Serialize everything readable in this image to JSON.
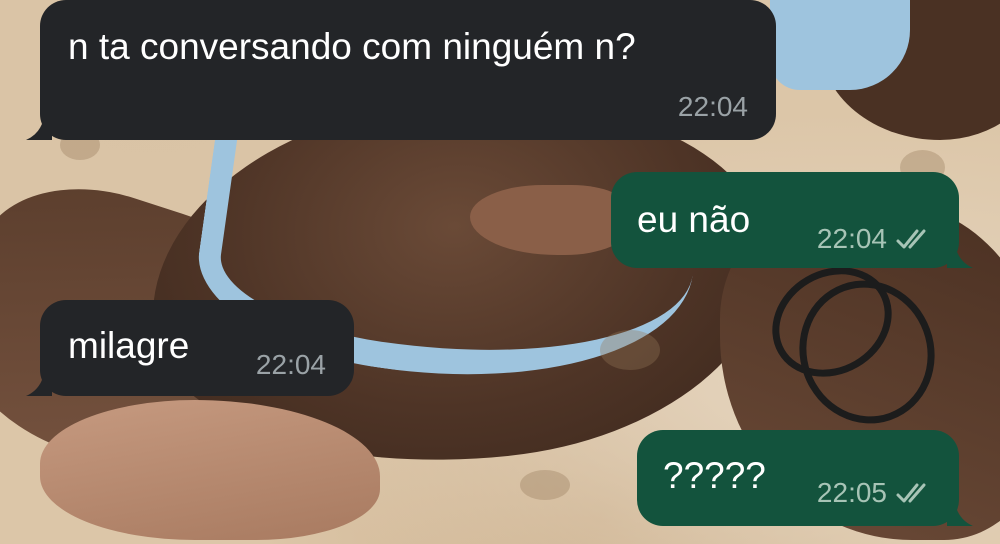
{
  "chat": {
    "messages": [
      {
        "direction": "incoming",
        "text": "n ta conversando com ninguém n?",
        "time": "22:04"
      },
      {
        "direction": "outgoing",
        "text": "eu não",
        "time": "22:04",
        "status": "read-double-check"
      },
      {
        "direction": "incoming",
        "text": "milagre",
        "time": "22:04"
      },
      {
        "direction": "outgoing",
        "text": "?????",
        "time": "22:05",
        "status": "read-double-check"
      }
    ]
  },
  "theme": {
    "incoming_bubble": "#232528",
    "outgoing_bubble": "#13533d",
    "text": "#ffffff",
    "incoming_meta": "#9aa2a6",
    "outgoing_meta": "#a7c4b6"
  }
}
